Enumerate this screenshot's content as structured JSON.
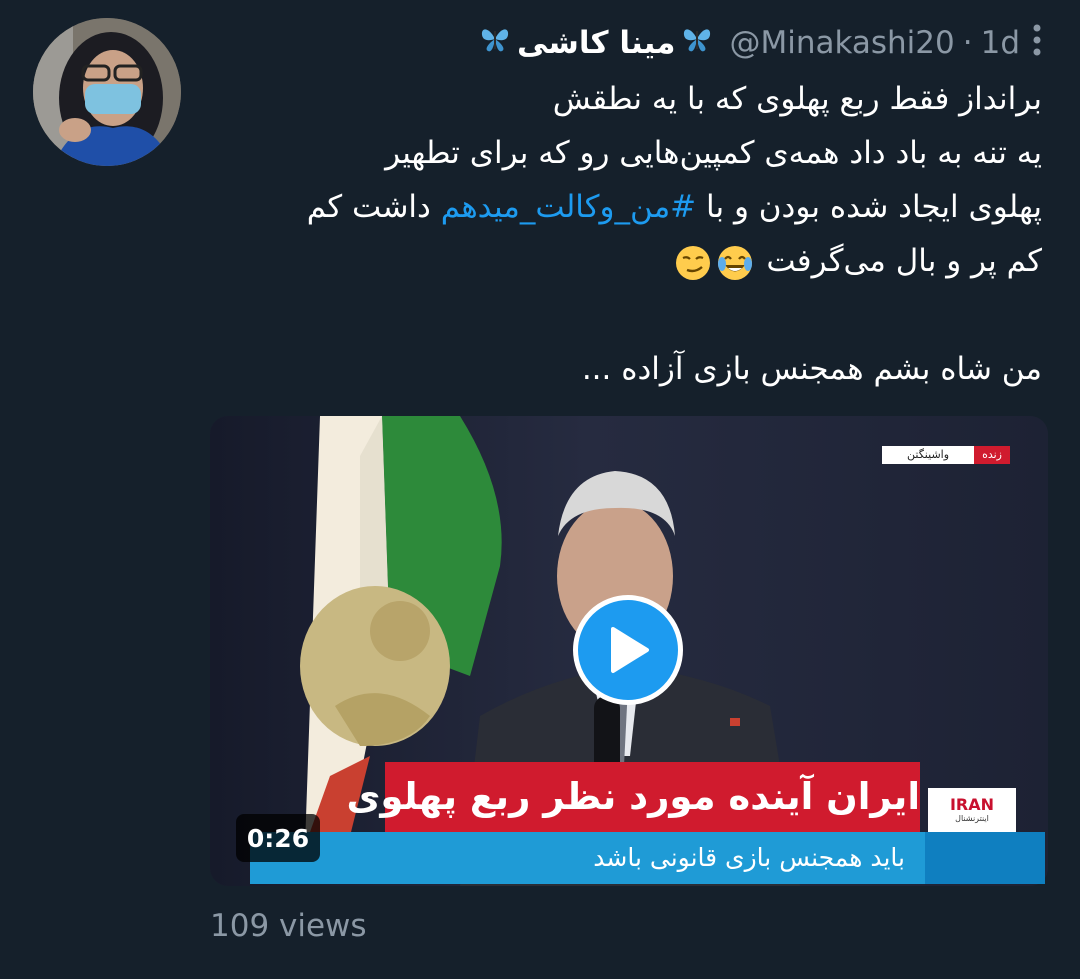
{
  "tweet": {
    "display_name": "مینا کاشی",
    "handle": "@Minakashi20",
    "separator": "·",
    "time": "1d",
    "text_lines": [
      "برانداز فقط ربع پهلوی که با یه نطقش",
      "یه تنه به باد داد همه‌ی کمپین‌هایی رو که برای تطهیر",
      "کم پر و بال می‌گرفت",
      "من شاه بشم همجنس بازی آزاده ..."
    ],
    "line3_before": "پهلوی ایجاد شده بودن و با ",
    "hashtag": "#من_وکالت_میدهم",
    "line3_after": " داشت کم",
    "emojis": [
      "face-with-tears-of-joy",
      "smirking-face"
    ],
    "views": "109 views"
  },
  "video": {
    "duration": "0:26",
    "caption_main": "ایران آینده مورد نظر ربع پهلوی",
    "caption_sub": "باید همجنس بازی قانونی باشد",
    "live_label": "زنده",
    "city_label": "واشینگتن",
    "channel_logo": "IRAN",
    "channel_logo_sub": "اینترنشنال"
  },
  "icons": {
    "name_badge": "butterfly-icon",
    "more": "more-options-icon",
    "play": "play-icon"
  },
  "colors": {
    "background": "#15202b",
    "accent": "#1d9bf0",
    "secondary_text": "#8b98a5"
  }
}
